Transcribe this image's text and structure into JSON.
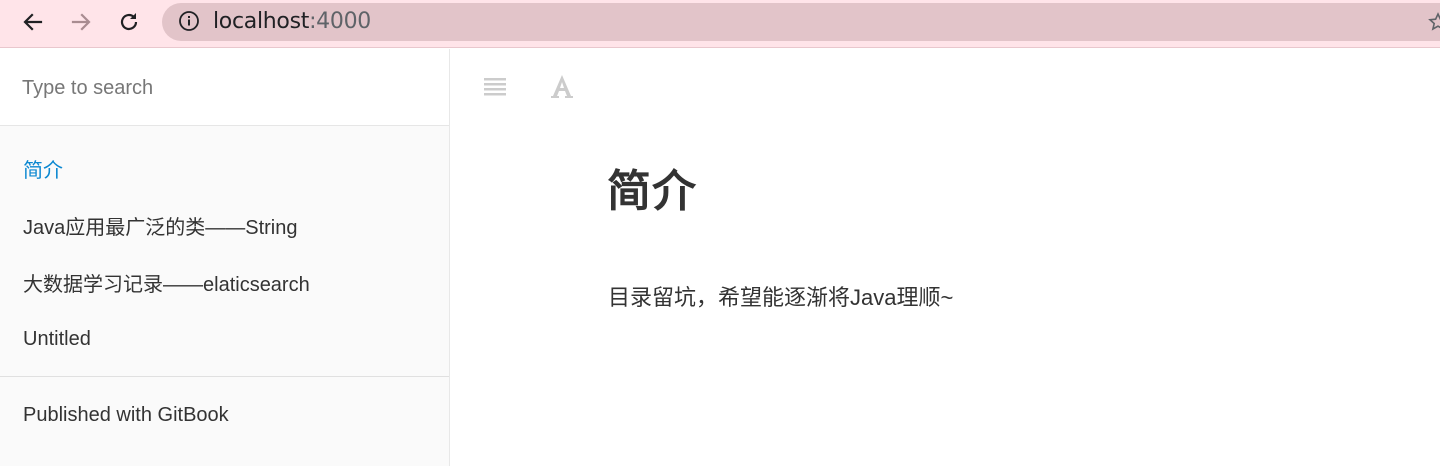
{
  "browser": {
    "url_host": "localhost",
    "url_port": ":4000",
    "icons": [
      "back-arrow-icon",
      "forward-arrow-icon",
      "reload-icon",
      "info-icon",
      "star-icon"
    ]
  },
  "sidebar": {
    "search_placeholder": "Type to search",
    "items": [
      {
        "label": "简介",
        "active": true
      },
      {
        "label": "Java应用最广泛的类——String",
        "active": false
      },
      {
        "label": "大数据学习记录——elaticsearch",
        "active": false
      },
      {
        "label": "Untitled",
        "active": false
      }
    ],
    "footer": "Published with GitBook"
  },
  "toolbar": {
    "icons": [
      "menu-icon",
      "font-settings-icon"
    ]
  },
  "content": {
    "title": "简介",
    "text": "目录留坑，希望能逐渐将Java理顺~"
  },
  "colors": {
    "browser_bar": "#ffe4e9",
    "omnibox": "#e2c4c9",
    "sidebar_bg": "#fafafa",
    "active_link": "#0c88d1",
    "text": "#333333"
  }
}
